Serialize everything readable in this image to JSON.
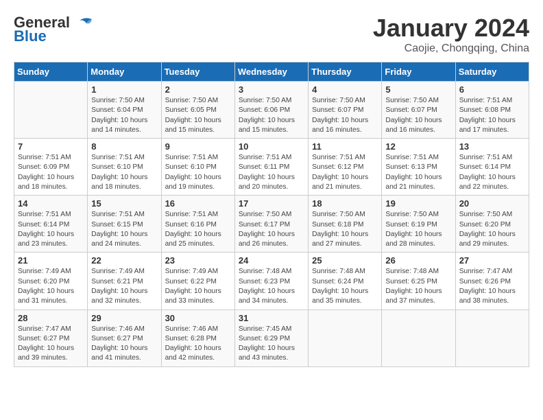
{
  "header": {
    "logo_general": "General",
    "logo_blue": "Blue",
    "month_year": "January 2024",
    "location": "Caojie, Chongqing, China"
  },
  "days_of_week": [
    "Sunday",
    "Monday",
    "Tuesday",
    "Wednesday",
    "Thursday",
    "Friday",
    "Saturday"
  ],
  "weeks": [
    [
      {
        "day": "",
        "info": ""
      },
      {
        "day": "1",
        "info": "Sunrise: 7:50 AM\nSunset: 6:04 PM\nDaylight: 10 hours\nand 14 minutes."
      },
      {
        "day": "2",
        "info": "Sunrise: 7:50 AM\nSunset: 6:05 PM\nDaylight: 10 hours\nand 15 minutes."
      },
      {
        "day": "3",
        "info": "Sunrise: 7:50 AM\nSunset: 6:06 PM\nDaylight: 10 hours\nand 15 minutes."
      },
      {
        "day": "4",
        "info": "Sunrise: 7:50 AM\nSunset: 6:07 PM\nDaylight: 10 hours\nand 16 minutes."
      },
      {
        "day": "5",
        "info": "Sunrise: 7:50 AM\nSunset: 6:07 PM\nDaylight: 10 hours\nand 16 minutes."
      },
      {
        "day": "6",
        "info": "Sunrise: 7:51 AM\nSunset: 6:08 PM\nDaylight: 10 hours\nand 17 minutes."
      }
    ],
    [
      {
        "day": "7",
        "info": "Sunrise: 7:51 AM\nSunset: 6:09 PM\nDaylight: 10 hours\nand 18 minutes."
      },
      {
        "day": "8",
        "info": "Sunrise: 7:51 AM\nSunset: 6:10 PM\nDaylight: 10 hours\nand 18 minutes."
      },
      {
        "day": "9",
        "info": "Sunrise: 7:51 AM\nSunset: 6:10 PM\nDaylight: 10 hours\nand 19 minutes."
      },
      {
        "day": "10",
        "info": "Sunrise: 7:51 AM\nSunset: 6:11 PM\nDaylight: 10 hours\nand 20 minutes."
      },
      {
        "day": "11",
        "info": "Sunrise: 7:51 AM\nSunset: 6:12 PM\nDaylight: 10 hours\nand 21 minutes."
      },
      {
        "day": "12",
        "info": "Sunrise: 7:51 AM\nSunset: 6:13 PM\nDaylight: 10 hours\nand 21 minutes."
      },
      {
        "day": "13",
        "info": "Sunrise: 7:51 AM\nSunset: 6:14 PM\nDaylight: 10 hours\nand 22 minutes."
      }
    ],
    [
      {
        "day": "14",
        "info": "Sunrise: 7:51 AM\nSunset: 6:14 PM\nDaylight: 10 hours\nand 23 minutes."
      },
      {
        "day": "15",
        "info": "Sunrise: 7:51 AM\nSunset: 6:15 PM\nDaylight: 10 hours\nand 24 minutes."
      },
      {
        "day": "16",
        "info": "Sunrise: 7:51 AM\nSunset: 6:16 PM\nDaylight: 10 hours\nand 25 minutes."
      },
      {
        "day": "17",
        "info": "Sunrise: 7:50 AM\nSunset: 6:17 PM\nDaylight: 10 hours\nand 26 minutes."
      },
      {
        "day": "18",
        "info": "Sunrise: 7:50 AM\nSunset: 6:18 PM\nDaylight: 10 hours\nand 27 minutes."
      },
      {
        "day": "19",
        "info": "Sunrise: 7:50 AM\nSunset: 6:19 PM\nDaylight: 10 hours\nand 28 minutes."
      },
      {
        "day": "20",
        "info": "Sunrise: 7:50 AM\nSunset: 6:20 PM\nDaylight: 10 hours\nand 29 minutes."
      }
    ],
    [
      {
        "day": "21",
        "info": "Sunrise: 7:49 AM\nSunset: 6:20 PM\nDaylight: 10 hours\nand 31 minutes."
      },
      {
        "day": "22",
        "info": "Sunrise: 7:49 AM\nSunset: 6:21 PM\nDaylight: 10 hours\nand 32 minutes."
      },
      {
        "day": "23",
        "info": "Sunrise: 7:49 AM\nSunset: 6:22 PM\nDaylight: 10 hours\nand 33 minutes."
      },
      {
        "day": "24",
        "info": "Sunrise: 7:48 AM\nSunset: 6:23 PM\nDaylight: 10 hours\nand 34 minutes."
      },
      {
        "day": "25",
        "info": "Sunrise: 7:48 AM\nSunset: 6:24 PM\nDaylight: 10 hours\nand 35 minutes."
      },
      {
        "day": "26",
        "info": "Sunrise: 7:48 AM\nSunset: 6:25 PM\nDaylight: 10 hours\nand 37 minutes."
      },
      {
        "day": "27",
        "info": "Sunrise: 7:47 AM\nSunset: 6:26 PM\nDaylight: 10 hours\nand 38 minutes."
      }
    ],
    [
      {
        "day": "28",
        "info": "Sunrise: 7:47 AM\nSunset: 6:27 PM\nDaylight: 10 hours\nand 39 minutes."
      },
      {
        "day": "29",
        "info": "Sunrise: 7:46 AM\nSunset: 6:27 PM\nDaylight: 10 hours\nand 41 minutes."
      },
      {
        "day": "30",
        "info": "Sunrise: 7:46 AM\nSunset: 6:28 PM\nDaylight: 10 hours\nand 42 minutes."
      },
      {
        "day": "31",
        "info": "Sunrise: 7:45 AM\nSunset: 6:29 PM\nDaylight: 10 hours\nand 43 minutes."
      },
      {
        "day": "",
        "info": ""
      },
      {
        "day": "",
        "info": ""
      },
      {
        "day": "",
        "info": ""
      }
    ]
  ]
}
